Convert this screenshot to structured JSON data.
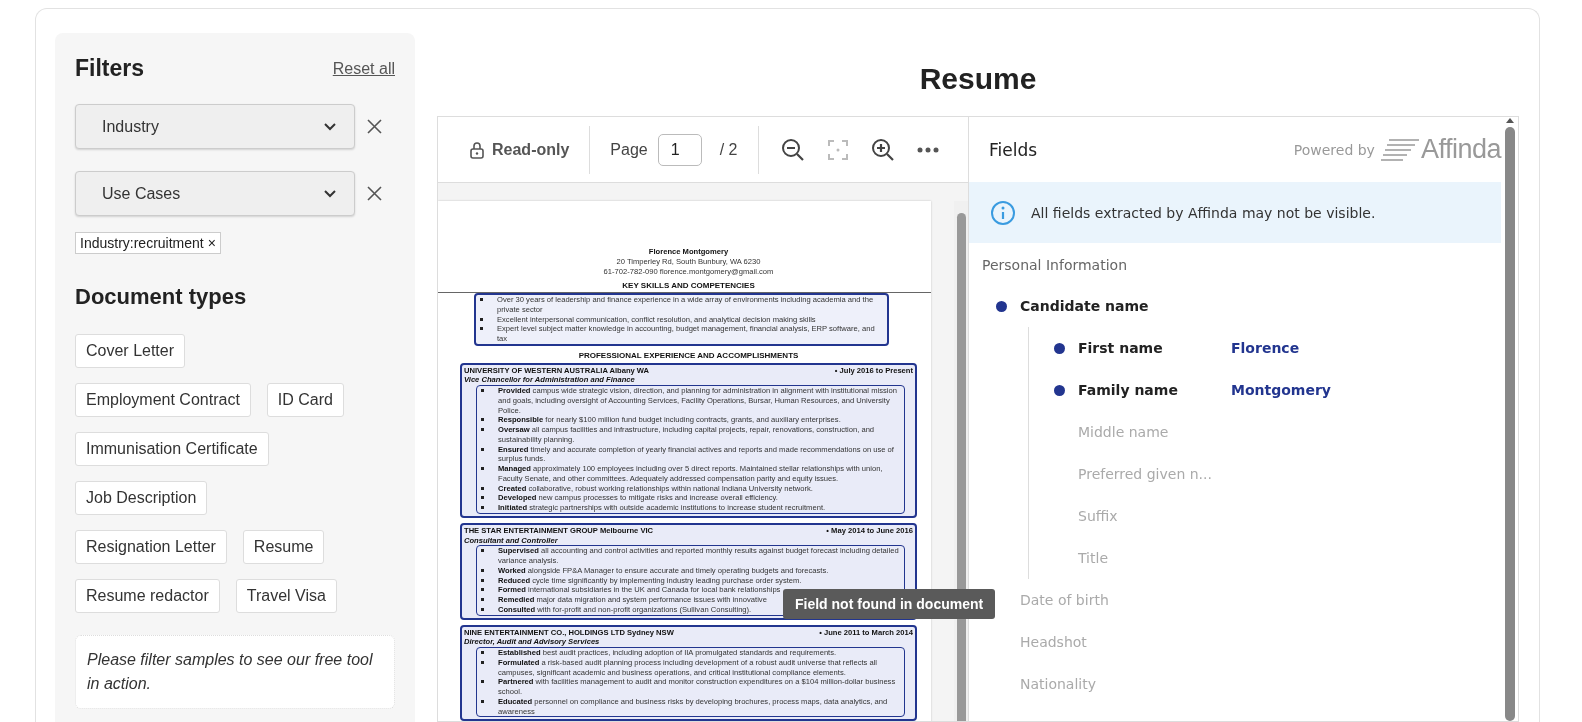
{
  "filters": {
    "title": "Filters",
    "reset_link": "Reset all",
    "dropdowns": [
      {
        "label": "Industry"
      },
      {
        "label": "Use Cases"
      }
    ],
    "chips": [
      {
        "label": "Industry:recruitment",
        "remove": "×"
      }
    ],
    "document_types_title": "Document types",
    "document_types": [
      "Cover Letter",
      "Employment Contract",
      "ID Card",
      "Immunisation Certificate",
      "Job Description",
      "Resignation Letter",
      "Resume",
      "Resume redactor",
      "Travel Visa"
    ],
    "note": "Please filter samples to see our free tool in action."
  },
  "title": "Resume",
  "viewer": {
    "read_only": "Read-only",
    "page_label": "Page",
    "page_value": "1",
    "page_total": "/ 2",
    "tooltip": "Field not found in document",
    "document": {
      "name": "Florence Montgomery",
      "address": "20 Timperley Rd, South Bunbury, WA 6230",
      "phone": "61-702-782-090",
      "email": "florence.montgomery@gmail.com",
      "skills_heading": "KEY SKILLS AND COMPETENCIES",
      "skills": [
        "Over 30 years of leadership and finance experience in a wide array of environments including academia and the private sector",
        "Excellent interpersonal communication, conflict resolution, and analytical decision making skills",
        "Expert level subject matter knowledge in accounting, budget management, financial analysis, ERP software, and tax"
      ],
      "experience_heading": "PROFESSIONAL EXPERIENCE AND ACCOMPLISHMENTS",
      "jobs": [
        {
          "company": "UNIVERSITY OF WESTERN AUSTRALIA",
          "location": "Albany WA",
          "dates": "• July 2016 to Present",
          "role": "Vice Chancellor for Administration and Finance",
          "bullets": [
            "**Provided** campus wide strategic vision, direction, and planning for administration in alignment with institutional mission and goals, including oversight of Accounting Services, Facility Operations, Bursar, Human Resources, and University Police.",
            "**Responsible** for nearly $100 million fund budget including contracts, grants, and auxiliary enterprises.",
            "**Oversaw** all campus facilities and infrastructure, including capital projects, repair, renovations, construction, and sustainability planning.",
            "**Ensured** timely and accurate completion of yearly financial actives and reports and made recommendations on use of surplus funds.",
            "**Managed** approximately 100 employees including over 5 direct reports. Maintained stellar relationships with union, Faculty Senate, and other committees. Adequately addressed compensation parity and equity issues.",
            "**Created** collaborative, robust working relationships within national Indiana University network.",
            "**Developed** new campus processes to mitigate risks and increase overall efficiency.",
            "**Initiated** strategic partnerships with outside academic institutions to increase student recruitment."
          ]
        },
        {
          "company": "THE STAR ENTERTAINMENT GROUP",
          "location": "Melbourne VIC",
          "dates": "• May 2014 to June 2016",
          "role": "Consultant and Controller",
          "bullets": [
            "**Supervised** all accounting and control activities and reported monthly results against budget forecast including detailed variance analysis.",
            "**Worked** alongside FP&A Manager to ensure accurate and timely operating budgets and forecasts.",
            "**Reduced** cycle time significantly by implementing industry leading purchase order system.",
            "**Formed** international subsidiaries in the UK and Canada for local bank relationships",
            "**Remedied** major data migration and system performance issues with innovative",
            "**Consulted** with for-profit and non-profit organizations (Sullivan Consulting)."
          ]
        },
        {
          "company": "NINE ENTERTAINMENT CO., HOLDINGS LTD",
          "location": "Sydney NSW",
          "dates": "• June 2011 to March 2014",
          "role": "Director, Audit and Advisory Services",
          "bullets": [
            "**Established** best audit practices, including adoption of IIA promulgated standards and requirements.",
            "**Formulated** a risk-based audit planning process including development of a robust audit universe that reflects all campuses, significant academic and business operations, and critical institutional compliance elements.",
            "**Partnered** with facilities management to audit and monitor construction expenditures on a $104 million-dollar business school.",
            "**Educated** personnel on compliance and business risks by developing brochures, process maps, data analytics, and awareness"
          ]
        }
      ]
    }
  },
  "fields_panel": {
    "title": "Fields",
    "powered_by": "Powered by",
    "brand": "Affinda",
    "notice": "All fields extracted by Affinda may not be visible.",
    "section": "Personal Information",
    "fields": [
      {
        "label": "Candidate name",
        "found": true,
        "children": [
          {
            "label": "First name",
            "value": "Florence",
            "found": true
          },
          {
            "label": "Family name",
            "value": "Montgomery",
            "found": true
          },
          {
            "label": "Middle name",
            "found": false
          },
          {
            "label": "Preferred given n...",
            "found": false
          },
          {
            "label": "Suffix",
            "found": false
          },
          {
            "label": "Title",
            "found": false
          }
        ]
      },
      {
        "label": "Date of birth",
        "found": false
      },
      {
        "label": "Headshot",
        "found": false
      },
      {
        "label": "Nationality",
        "found": false
      }
    ]
  }
}
